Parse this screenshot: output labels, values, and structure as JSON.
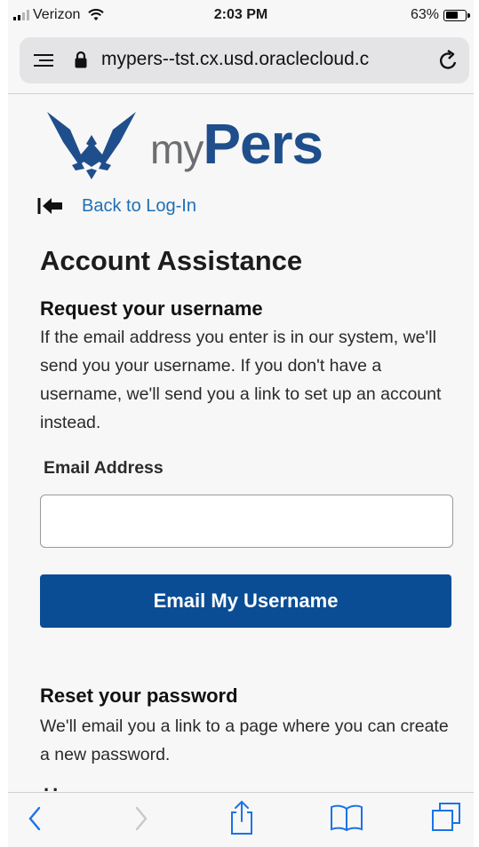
{
  "status_bar": {
    "carrier": "Verizon",
    "time": "2:03 PM",
    "battery_percent": "63%",
    "battery_level": 0.63,
    "icons": [
      "signal-icon",
      "wifi-icon",
      "battery-icon"
    ]
  },
  "url_bar": {
    "url": "mypers--tst.cx.usd.oraclecloud.c",
    "icons": [
      "reader-icon",
      "lock-icon",
      "reload-icon"
    ]
  },
  "logo": {
    "my": "my",
    "pers": "Pers",
    "brand_color": "#1f4e8c",
    "my_color": "#6d6e71"
  },
  "back": {
    "label": "Back to Log-In",
    "icon": "back-arrow-icon"
  },
  "page": {
    "title": "Account Assistance"
  },
  "username_section": {
    "title": "Request your username",
    "description": "If the email address you enter is in our system, we'll send you your username. If you don't have a username, we'll send you a link to set up an account instead.",
    "email_label": "Email Address",
    "email_value": "",
    "email_placeholder": "",
    "button_label": "Email My Username"
  },
  "password_section": {
    "title": "Reset your password",
    "description": "We'll email you a link to a page where you can create a new password."
  },
  "toolbar": {
    "icons": [
      "back-icon",
      "forward-icon",
      "share-icon",
      "bookmarks-icon",
      "tabs-icon"
    ],
    "accent": "#1a73e8"
  },
  "colors": {
    "button_bg": "#0a4d94",
    "link": "#1f6fb5"
  }
}
